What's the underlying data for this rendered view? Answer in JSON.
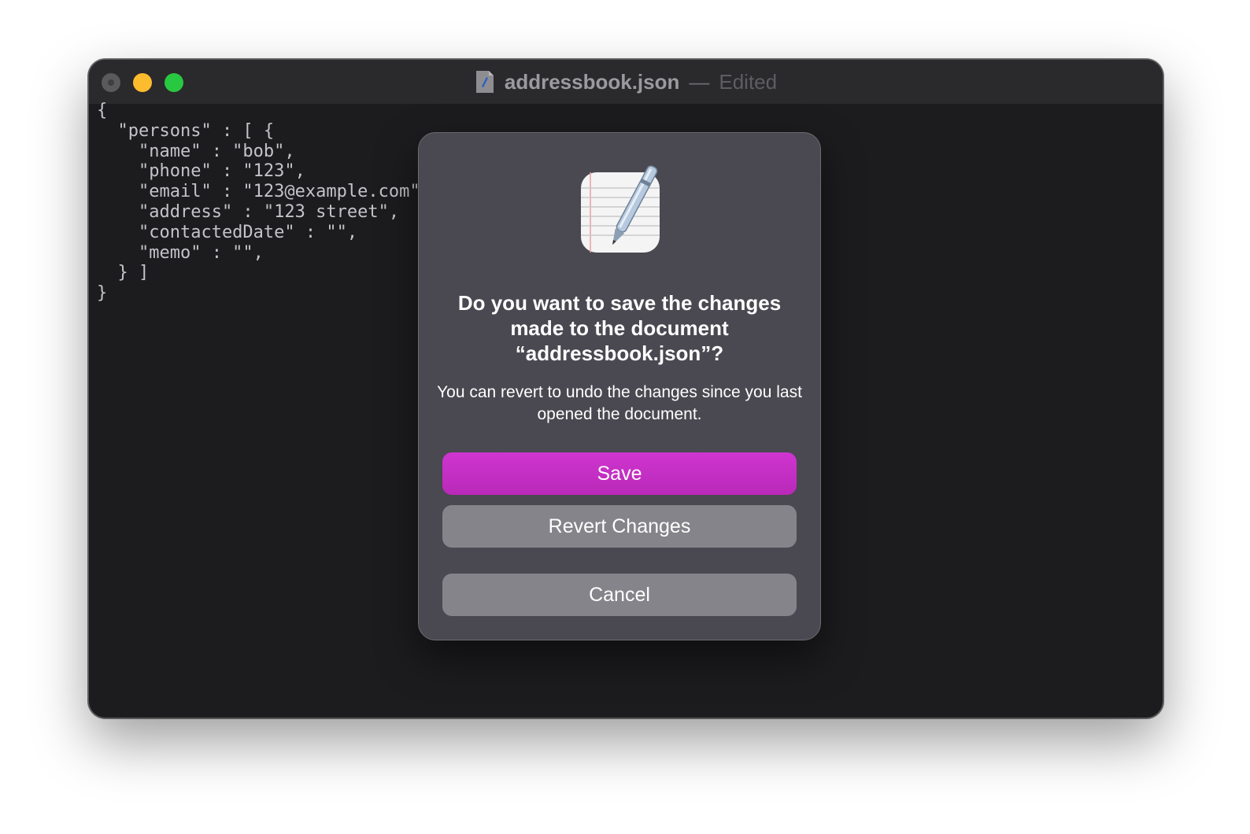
{
  "window": {
    "title": "addressbook.json",
    "separator": "—",
    "status": "Edited"
  },
  "editor": {
    "content": "{\n  \"persons\" : [ {\n    \"name\" : \"bob\",\n    \"phone\" : \"123\",\n    \"email\" : \"123@example.com\"\n    \"address\" : \"123 street\",\n    \"contactedDate\" : \"\",\n    \"memo\" : \"\",\n  } ]\n}"
  },
  "dialog": {
    "icon": "textedit-app-icon",
    "title": "Do you want to save the changes made to the document “addressbook.json”?",
    "message": "You can revert to undo the changes since you last opened the document.",
    "buttons": {
      "save": "Save",
      "revert": "Revert Changes",
      "cancel": "Cancel"
    }
  },
  "colors": {
    "save_button": "#c42fc4",
    "secondary_button": "#86848b",
    "window_background": "#1c1b1e",
    "dialog_background": "#4a4850"
  }
}
